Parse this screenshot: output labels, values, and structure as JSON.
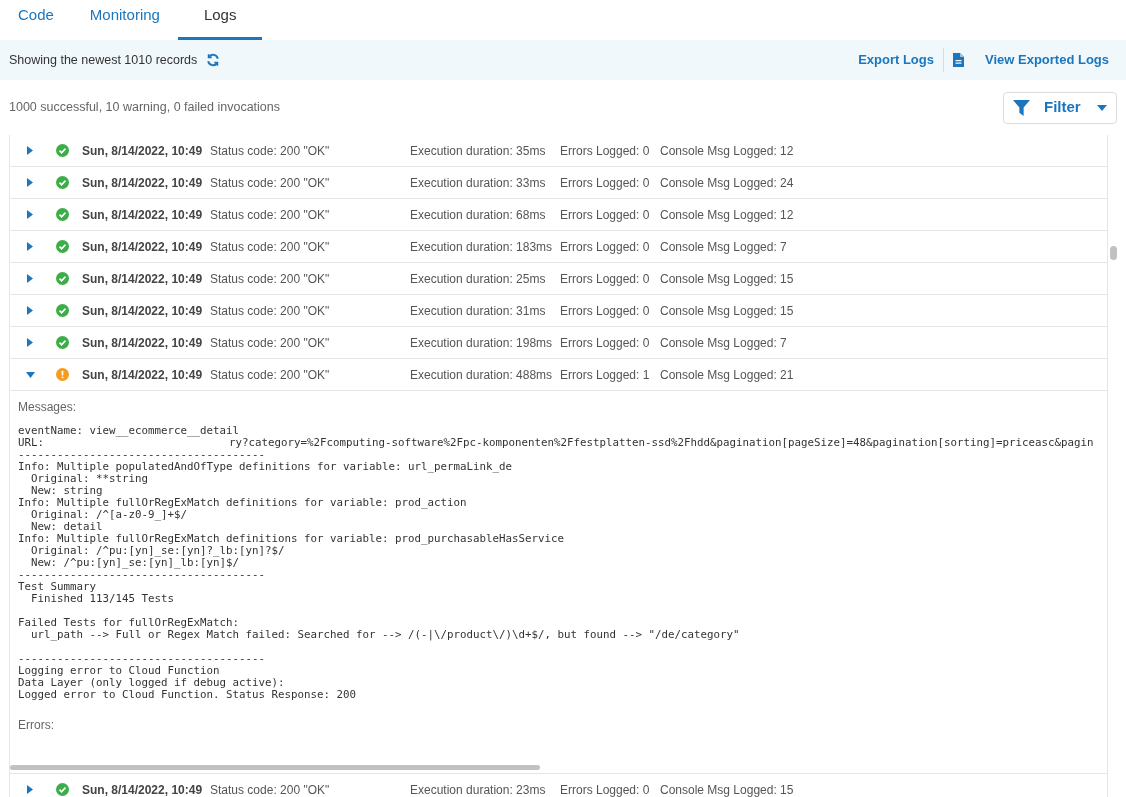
{
  "tabs": [
    {
      "label": "Code",
      "selected": false
    },
    {
      "label": "Monitoring",
      "selected": false
    },
    {
      "label": "Logs",
      "selected": true
    }
  ],
  "toolbar": {
    "records_text": "Showing the newest 1010 records",
    "export_logs": "Export Logs",
    "view_exported": "View Exported Logs"
  },
  "summary": "1000 successful, 10 warning, 0 failed invocations",
  "filter": {
    "label": "Filter"
  },
  "rows": [
    {
      "kind": "success",
      "expanded": false,
      "date": "Sun, 8/14/2022, 10:49",
      "status_code": "Status code: 200 \"OK\"",
      "duration": "Execution duration: 35ms",
      "errors": "Errors Logged: 0",
      "console": "Console Msg Logged: 12"
    },
    {
      "kind": "success",
      "expanded": false,
      "date": "Sun, 8/14/2022, 10:49",
      "status_code": "Status code: 200 \"OK\"",
      "duration": "Execution duration: 33ms",
      "errors": "Errors Logged: 0",
      "console": "Console Msg Logged: 24"
    },
    {
      "kind": "success",
      "expanded": false,
      "date": "Sun, 8/14/2022, 10:49",
      "status_code": "Status code: 200 \"OK\"",
      "duration": "Execution duration: 68ms",
      "errors": "Errors Logged: 0",
      "console": "Console Msg Logged: 12"
    },
    {
      "kind": "success",
      "expanded": false,
      "date": "Sun, 8/14/2022, 10:49",
      "status_code": "Status code: 200 \"OK\"",
      "duration": "Execution duration: 183ms",
      "errors": "Errors Logged: 0",
      "console": "Console Msg Logged: 7"
    },
    {
      "kind": "success",
      "expanded": false,
      "date": "Sun, 8/14/2022, 10:49",
      "status_code": "Status code: 200 \"OK\"",
      "duration": "Execution duration: 25ms",
      "errors": "Errors Logged: 0",
      "console": "Console Msg Logged: 15"
    },
    {
      "kind": "success",
      "expanded": false,
      "date": "Sun, 8/14/2022, 10:49",
      "status_code": "Status code: 200 \"OK\"",
      "duration": "Execution duration: 31ms",
      "errors": "Errors Logged: 0",
      "console": "Console Msg Logged: 15"
    },
    {
      "kind": "success",
      "expanded": false,
      "date": "Sun, 8/14/2022, 10:49",
      "status_code": "Status code: 200 \"OK\"",
      "duration": "Execution duration: 198ms",
      "errors": "Errors Logged: 0",
      "console": "Console Msg Logged: 7"
    },
    {
      "kind": "warning",
      "expanded": true,
      "date": "Sun, 8/14/2022, 10:49",
      "status_code": "Status code: 200 \"OK\"",
      "duration": "Execution duration: 488ms",
      "errors": "Errors Logged: 1",
      "console": "Console Msg Logged: 21",
      "details": {
        "messages_label": "Messages:",
        "errors_label": "Errors:",
        "lines": [
          {
            "kind": "text",
            "text": "eventName: view__ecommerce__detail"
          },
          {
            "kind": "url",
            "label": "URL:",
            "text": "ry?category=%2Fcomputing-software%2Fpc-komponenten%2Ffestplatten-ssd%2Fhdd&pagination[pageSize]=48&pagination[sorting]=priceasc&pagin"
          },
          {
            "kind": "text",
            "text": "--------------------------------------"
          },
          {
            "kind": "text",
            "text": "Info: Multiple populatedAndOfType definitions for variable: url_permaLink_de"
          },
          {
            "kind": "text",
            "text": "  Original: **string"
          },
          {
            "kind": "text",
            "text": "  New: string"
          },
          {
            "kind": "text",
            "text": "Info: Multiple fullOrRegExMatch definitions for variable: prod_action"
          },
          {
            "kind": "text",
            "text": "  Original: /^[a-z0-9_]+$/"
          },
          {
            "kind": "text",
            "text": "  New: detail"
          },
          {
            "kind": "text",
            "text": "Info: Multiple fullOrRegExMatch definitions for variable: prod_purchasableHasService"
          },
          {
            "kind": "text",
            "text": "  Original: /^pu:[yn]_se:[yn]?_lb:[yn]?$/"
          },
          {
            "kind": "text",
            "text": "  New: /^pu:[yn]_se:[yn]_lb:[yn]$/"
          },
          {
            "kind": "text",
            "text": "--------------------------------------"
          },
          {
            "kind": "text",
            "text": "Test Summary"
          },
          {
            "kind": "text",
            "text": "  Finished 113/145 Tests"
          },
          {
            "kind": "blank"
          },
          {
            "kind": "text",
            "text": "Failed Tests for fullOrRegExMatch:"
          },
          {
            "kind": "text",
            "text": "  url_path --> Full or Regex Match failed: Searched for --> /(-|\\/product\\/)\\d+$/, but found --> \"/de/category\""
          },
          {
            "kind": "blank"
          },
          {
            "kind": "text",
            "text": "--------------------------------------"
          },
          {
            "kind": "text",
            "text": "Logging error to Cloud Function"
          },
          {
            "kind": "text",
            "text": "Data Layer (only logged if debug active):"
          },
          {
            "kind": "text",
            "text": "Logged error to Cloud Function. Status Response: 200"
          }
        ]
      }
    },
    {
      "kind": "success",
      "expanded": false,
      "date": "Sun, 8/14/2022, 10:49",
      "status_code": "Status code: 200 \"OK\"",
      "duration": "Execution duration: 23ms",
      "errors": "Errors Logged: 0",
      "console": "Console Msg Logged: 15"
    }
  ]
}
